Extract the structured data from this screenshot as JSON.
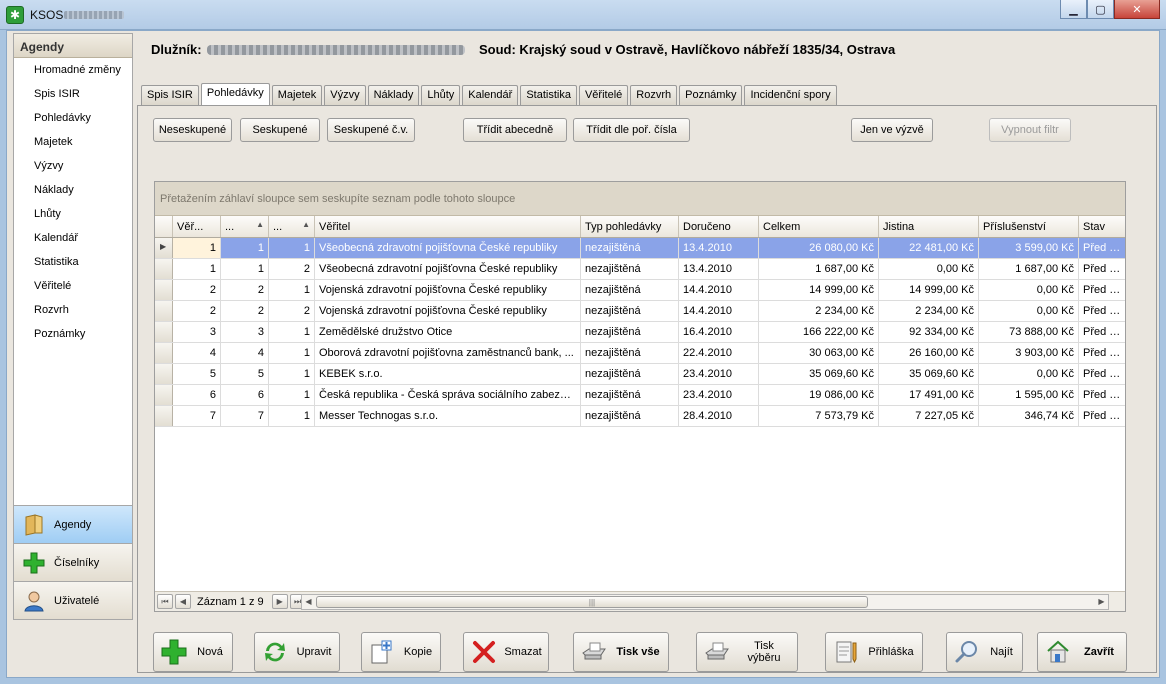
{
  "window": {
    "title": "KSOS"
  },
  "header": {
    "debtor_label": "Dlužník:",
    "court_text": "Soud: Krajský soud v Ostravě, Havlíčkovo nábřeží 1835/34, Ostrava"
  },
  "sidebar": {
    "header": "Agendy",
    "items": [
      "Hromadné změny",
      "Spis ISIR",
      "Pohledávky",
      "Majetek",
      "Výzvy",
      "Náklady",
      "Lhůty",
      "Kalendář",
      "Statistika",
      "Věřitelé",
      "Rozvrh",
      "Poznámky"
    ],
    "buttons": [
      {
        "label": "Agendy",
        "icon": "folder-icon"
      },
      {
        "label": "Číselníky",
        "icon": "plus-icon"
      },
      {
        "label": "Uživatelé",
        "icon": "user-icon"
      }
    ]
  },
  "tabs": [
    "Spis ISIR",
    "Pohledávky",
    "Majetek",
    "Výzvy",
    "Náklady",
    "Lhůty",
    "Kalendář",
    "Statistika",
    "Věřitelé",
    "Rozvrh",
    "Poznámky",
    "Incidenční spory"
  ],
  "active_tab": "Pohledávky",
  "toolbar": {
    "ungrouped": "Neseskupené",
    "grouped": "Seskupené",
    "grouped_cv": "Seskupené č.v.",
    "sort_alpha": "Třídit abecedně",
    "sort_order": "Třídit dle poř. čísla",
    "only_in_call": "Jen ve výzvě",
    "filter_off": "Vypnout filtr"
  },
  "grid": {
    "group_hint": "Přetažením záhlaví sloupce sem seskupíte seznam podle tohoto sloupce",
    "columns": [
      "Věř...",
      "...",
      "...",
      "Věřitel",
      "Typ pohledávky",
      "Doručeno",
      "Celkem",
      "Jistina",
      "Příslušenství",
      "Stav"
    ],
    "rows": [
      [
        "1",
        "1",
        "1",
        "Všeobecná zdravotní pojišťovna České republiky",
        "nezajištěná",
        "13.4.2010",
        "26 080,00 Kč",
        "22 481,00 Kč",
        "3 599,00 Kč",
        "Před přez"
      ],
      [
        "1",
        "1",
        "2",
        "Všeobecná zdravotní pojišťovna České republiky",
        "nezajištěná",
        "13.4.2010",
        "1 687,00 Kč",
        "0,00 Kč",
        "1 687,00 Kč",
        "Před přez"
      ],
      [
        "2",
        "2",
        "1",
        "Vojenská zdravotní pojišťovna České republiky",
        "nezajištěná",
        "14.4.2010",
        "14 999,00 Kč",
        "14 999,00 Kč",
        "0,00 Kč",
        "Před přez"
      ],
      [
        "2",
        "2",
        "2",
        "Vojenská zdravotní pojišťovna České republiky",
        "nezajištěná",
        "14.4.2010",
        "2 234,00 Kč",
        "2 234,00 Kč",
        "0,00 Kč",
        "Před přez"
      ],
      [
        "3",
        "3",
        "1",
        "Zemědělské družstvo Otice",
        "nezajištěná",
        "16.4.2010",
        "166 222,00 Kč",
        "92 334,00 Kč",
        "73 888,00 Kč",
        "Před přez"
      ],
      [
        "4",
        "4",
        "1",
        "Oborová zdravotní pojišťovna zaměstnanců bank, ...",
        "nezajištěná",
        "22.4.2010",
        "30 063,00 Kč",
        "26 160,00 Kč",
        "3 903,00 Kč",
        "Před přez"
      ],
      [
        "5",
        "5",
        "1",
        "KEBEK s.r.o.",
        "nezajištěná",
        "23.4.2010",
        "35 069,60 Kč",
        "35 069,60 Kč",
        "0,00 Kč",
        "Před přez"
      ],
      [
        "6",
        "6",
        "1",
        "Česká republika - Česká správa sociálního zabezpeč...",
        "nezajištěná",
        "23.4.2010",
        "19 086,00 Kč",
        "17 491,00 Kč",
        "1 595,00 Kč",
        "Před přez"
      ],
      [
        "7",
        "7",
        "1",
        "Messer Technogas s.r.o.",
        "nezajištěná",
        "28.4.2010",
        "7 573,79 Kč",
        "7 227,05 Kč",
        "346,74 Kč",
        "Před přez"
      ]
    ],
    "record_info": "Záznam 1 z 9"
  },
  "actions": {
    "new": "Nová",
    "edit": "Upravit",
    "copy": "Kopie",
    "delete": "Smazat",
    "print_all": "Tisk vše",
    "print_selection": "Tisk výběru",
    "application": "Přihláška",
    "find": "Najít",
    "close": "Zavřít"
  },
  "colors": {
    "selection": "#8aa3e8",
    "panel": "#eae6df",
    "active_sidebar": "#9fcdf4"
  }
}
